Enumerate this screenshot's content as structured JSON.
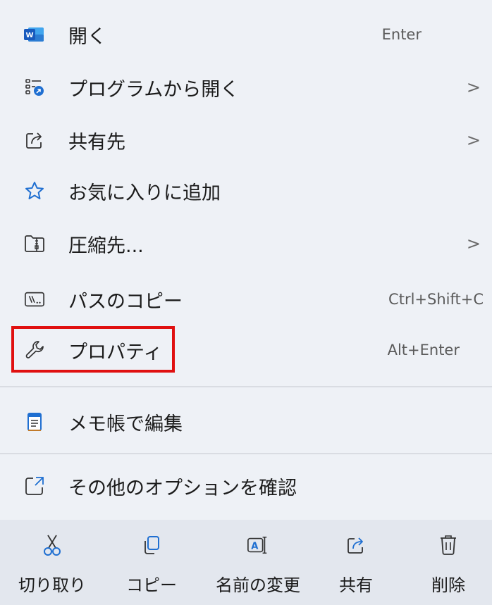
{
  "menu": {
    "items": [
      {
        "label": "開く",
        "shortcut": "Enter",
        "icon": "word-icon"
      },
      {
        "label": "プログラムから開く",
        "submenu": true,
        "icon": "open-with-icon"
      },
      {
        "label": "共有先",
        "submenu": true,
        "icon": "share-icon"
      },
      {
        "label": "お気に入りに追加",
        "icon": "star-icon"
      },
      {
        "label": "圧縮先...",
        "submenu": true,
        "icon": "zip-folder-icon"
      },
      {
        "label": "パスのコピー",
        "shortcut": "Ctrl+Shift+C",
        "icon": "copy-path-icon"
      },
      {
        "label": "プロパティ",
        "shortcut": "Alt+Enter",
        "icon": "wrench-icon"
      },
      {
        "label": "メモ帳で編集",
        "icon": "notepad-icon"
      },
      {
        "label": "その他のオプションを確認",
        "icon": "more-options-icon"
      }
    ],
    "arrow_glyph": ">"
  },
  "toolbar": {
    "buttons": [
      {
        "label": "切り取り",
        "icon": "scissors-icon"
      },
      {
        "label": "コピー",
        "icon": "copy-icon"
      },
      {
        "label": "名前の変更",
        "icon": "rename-icon"
      },
      {
        "label": "共有",
        "icon": "share-icon"
      },
      {
        "label": "削除",
        "icon": "trash-icon"
      }
    ]
  },
  "colors": {
    "background": "#eef1f6",
    "toolbar_background": "#e3e7ee",
    "highlight_border": "#e01010",
    "accent_blue": "#1f6fd1",
    "word_blue": "#185abd"
  }
}
